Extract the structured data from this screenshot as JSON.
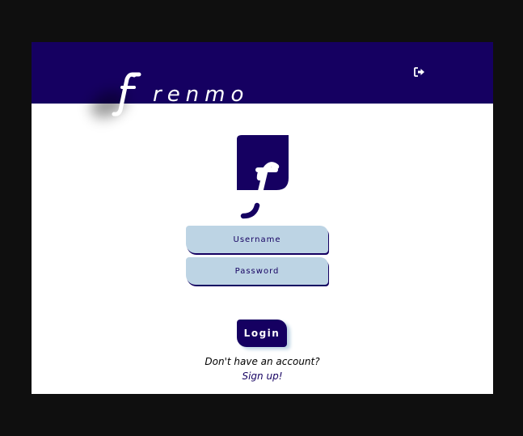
{
  "brand": {
    "name": "frenmo",
    "wordmark_initial": "f",
    "wordmark_rest": "renmo",
    "logo_icon": "frenmo-f-leaf-logo"
  },
  "header": {
    "logout_icon": "sign-out-icon"
  },
  "login_form": {
    "username_placeholder": "Username",
    "password_placeholder": "Password",
    "username_value": "",
    "password_value": "",
    "login_label": "Login"
  },
  "signup": {
    "prompt": "Don't have an account?",
    "link_label": "Sign up!"
  },
  "colors": {
    "primary_navy": "#150061",
    "field_blue": "#bdd4e4",
    "page_background": "#ffffff",
    "outer_background": "#0f0f0f"
  }
}
